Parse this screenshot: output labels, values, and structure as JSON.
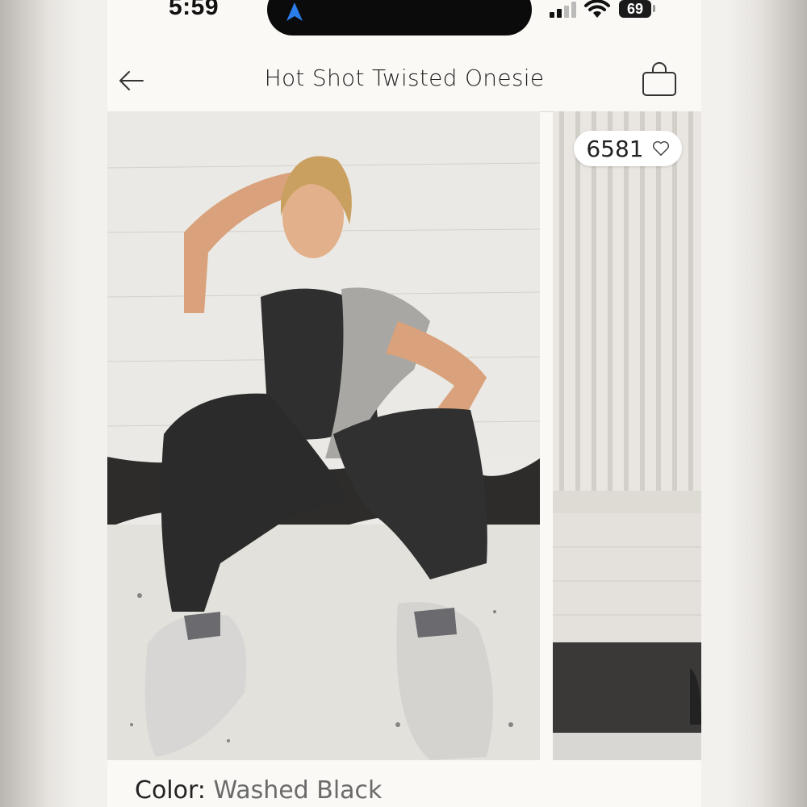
{
  "status_bar": {
    "time": "5:59",
    "battery": "69",
    "icons": [
      "location-arrow-icon",
      "signal-icon",
      "wifi-icon",
      "battery-icon"
    ]
  },
  "header": {
    "title": "Hot Shot Twisted Onesie",
    "back_icon": "back-arrow-icon",
    "bag_icon": "shopping-bag-icon"
  },
  "gallery": {
    "likes_count": "6581",
    "likes_icon": "heart-icon"
  },
  "product": {
    "color_label": "Color:",
    "color_value": "Washed Black"
  },
  "colors": {
    "accent": "#2b7de9",
    "background": "#fbf9f6",
    "text": "#222222"
  }
}
